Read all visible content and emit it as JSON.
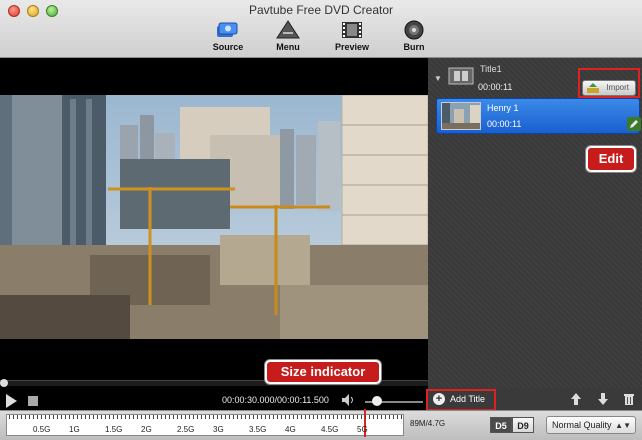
{
  "window": {
    "title": "Pavtube Free DVD Creator"
  },
  "toolbar": {
    "items": [
      {
        "label": "Source",
        "icon": "source-icon"
      },
      {
        "label": "Menu",
        "icon": "menu-icon"
      },
      {
        "label": "Preview",
        "icon": "film-icon"
      },
      {
        "label": "Burn",
        "icon": "disc-icon"
      }
    ]
  },
  "titles_panel": {
    "title": {
      "name": "Title1",
      "duration": "00:00:11"
    },
    "import_label": "Import",
    "clip": {
      "name": "Henry 1",
      "duration": "00:00:11"
    },
    "edit_callout": "Edit"
  },
  "player": {
    "timecode": "00:00:30.000/00:00:11.500",
    "volume_level": 0.3
  },
  "actions": {
    "add_title_label": "Add Title"
  },
  "size_bar": {
    "callout": "Size indicator",
    "tick_labels": [
      "0.5G",
      "1G",
      "1.5G",
      "2G",
      "2.5G",
      "3G",
      "3.5G",
      "4G",
      "4.5G",
      "5G"
    ],
    "used_gb": 4.7,
    "size_text": "89M/4.7G"
  },
  "disc": {
    "d5": "D5",
    "d9": "D9"
  },
  "quality": {
    "selected": "Normal Quality"
  },
  "colors": {
    "accent_blue": "#2a74dc",
    "callout_red": "#c71c1c",
    "panel_dark": "#3a3a3a"
  }
}
